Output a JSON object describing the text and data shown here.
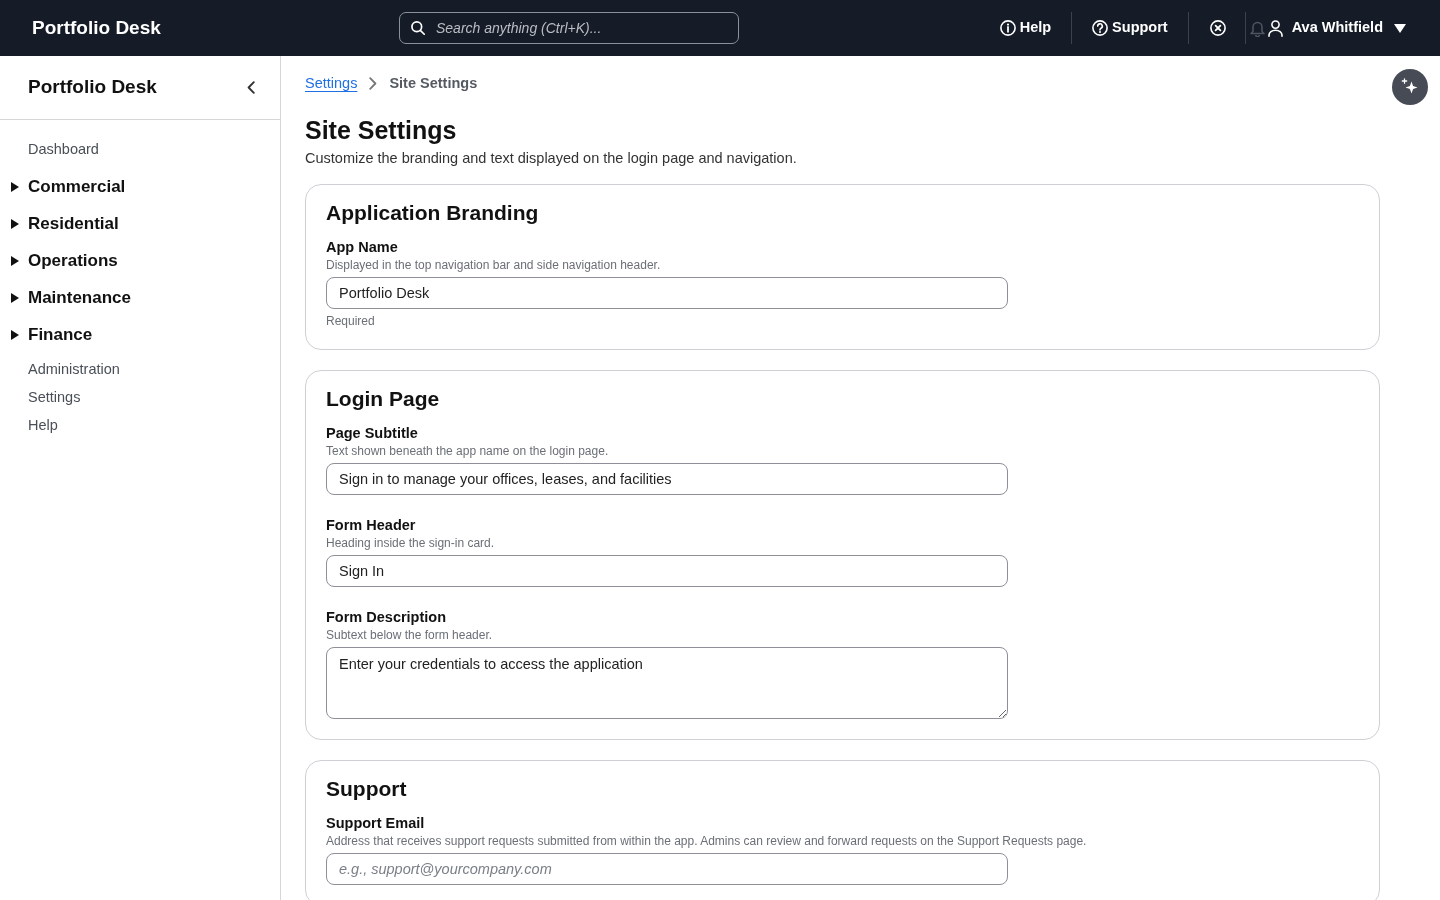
{
  "top_bar": {
    "brand": "Portfolio Desk",
    "search": {
      "placeholder": "Search anything (Ctrl+K)..."
    },
    "links": [
      {
        "kind": "help",
        "label": "Help"
      },
      {
        "kind": "support",
        "label": "Support"
      }
    ],
    "user": {
      "name": "Ava Whitfield"
    }
  },
  "sidebar": {
    "title": "Portfolio Desk",
    "items": [
      {
        "kind": "link",
        "label": "Dashboard"
      },
      {
        "kind": "group",
        "label": "Commercial",
        "expanded": false
      },
      {
        "kind": "group",
        "label": "Residential",
        "expanded": false
      },
      {
        "kind": "group",
        "label": "Operations",
        "expanded": false
      },
      {
        "kind": "group",
        "label": "Maintenance",
        "expanded": false
      },
      {
        "kind": "group",
        "label": "Finance",
        "expanded": false
      },
      {
        "kind": "link",
        "label": "Administration"
      },
      {
        "kind": "link",
        "label": "Settings"
      },
      {
        "kind": "link",
        "label": "Help"
      }
    ]
  },
  "breadcrumb": [
    {
      "kind": "link",
      "label": "Settings"
    },
    {
      "kind": "current",
      "label": "Site Settings"
    }
  ],
  "page": {
    "title": "Site Settings",
    "subtitle": "Customize the branding and text displayed on the login page and navigation."
  },
  "sections": [
    {
      "title": "Application Branding",
      "fields": [
        {
          "kind": "input",
          "label": "App Name",
          "help": "Displayed in the top navigation bar and side navigation header.",
          "value": "Portfolio Desk",
          "note": "Required"
        }
      ]
    },
    {
      "title": "Login Page",
      "fields": [
        {
          "kind": "input",
          "label": "Page Subtitle",
          "help": "Text shown beneath the app name on the login page.",
          "value": "Sign in to manage your offices, leases, and facilities"
        },
        {
          "kind": "input",
          "label": "Form Header",
          "help": "Heading inside the sign-in card.",
          "value": "Sign In"
        },
        {
          "kind": "textarea",
          "label": "Form Description",
          "help": "Subtext below the form header.",
          "value": "Enter your credentials to access the application"
        }
      ]
    },
    {
      "title": "Support",
      "fields": [
        {
          "kind": "input",
          "label": "Support Email",
          "help": "Address that receives support requests submitted from within the app. Admins can review and forward requests on the Support Requests page.",
          "placeholder": "e.g., support@yourcompany.com"
        }
      ]
    }
  ]
}
